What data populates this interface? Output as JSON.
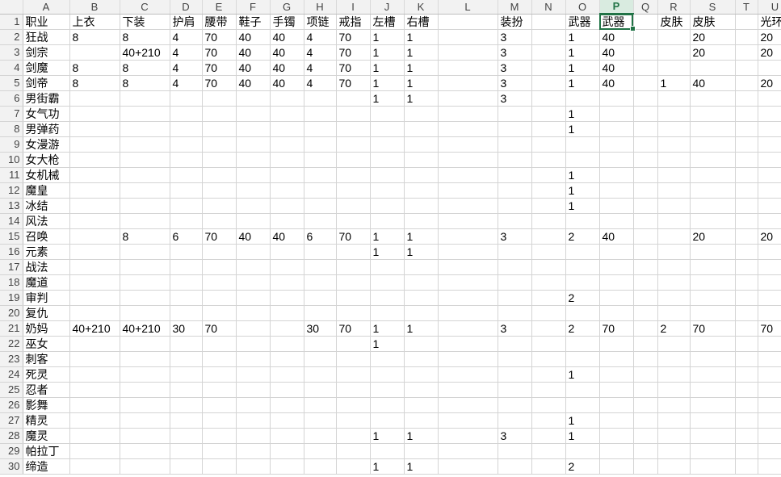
{
  "sheet": {
    "columns": [
      "A",
      "B",
      "C",
      "D",
      "E",
      "F",
      "G",
      "H",
      "I",
      "J",
      "K",
      "L",
      "M",
      "N",
      "O",
      "P",
      "Q",
      "R",
      "S",
      "T",
      "U"
    ],
    "active_column": "P",
    "selected_cell": "P1",
    "rows": [
      {
        "n": "1",
        "cells": [
          "职业",
          "上衣",
          "下装",
          "护肩",
          "腰带",
          "鞋子",
          "手镯",
          "项链",
          "戒指",
          "左槽",
          "右槽",
          "",
          "装扮",
          "",
          "武器",
          "武器",
          "",
          "皮肤",
          "皮肤",
          "",
          "光环"
        ]
      },
      {
        "n": "2",
        "cells": [
          "狂战",
          "8",
          "8",
          "4",
          "70",
          "40",
          "40",
          "4",
          "70",
          "1",
          "1",
          "",
          "3",
          "",
          "1",
          "40",
          "",
          "",
          "20",
          "",
          "20"
        ]
      },
      {
        "n": "3",
        "cells": [
          "剑宗",
          "",
          "40+210",
          "4",
          "70",
          "40",
          "40",
          "4",
          "70",
          "1",
          "1",
          "",
          "3",
          "",
          "1",
          "40",
          "",
          "",
          "20",
          "",
          "20"
        ]
      },
      {
        "n": "4",
        "cells": [
          "剑魔",
          "8",
          "8",
          "4",
          "70",
          "40",
          "40",
          "4",
          "70",
          "1",
          "1",
          "",
          "3",
          "",
          "1",
          "40",
          "",
          "",
          "",
          "",
          ""
        ]
      },
      {
        "n": "5",
        "cells": [
          "剑帝",
          "8",
          "8",
          "4",
          "70",
          "40",
          "40",
          "4",
          "70",
          "1",
          "1",
          "",
          "3",
          "",
          "1",
          "40",
          "",
          "1",
          "40",
          "",
          "20"
        ]
      },
      {
        "n": "6",
        "cells": [
          "男街霸",
          "",
          "",
          "",
          "",
          "",
          "",
          "",
          "",
          "1",
          "1",
          "",
          "3",
          "",
          "",
          "",
          "",
          "",
          "",
          "",
          ""
        ]
      },
      {
        "n": "7",
        "cells": [
          "女气功",
          "",
          "",
          "",
          "",
          "",
          "",
          "",
          "",
          "",
          "",
          "",
          "",
          "",
          "1",
          "",
          "",
          "",
          "",
          "",
          ""
        ]
      },
      {
        "n": "8",
        "cells": [
          "男弹药",
          "",
          "",
          "",
          "",
          "",
          "",
          "",
          "",
          "",
          "",
          "",
          "",
          "",
          "1",
          "",
          "",
          "",
          "",
          "",
          ""
        ]
      },
      {
        "n": "9",
        "cells": [
          "女漫游",
          "",
          "",
          "",
          "",
          "",
          "",
          "",
          "",
          "",
          "",
          "",
          "",
          "",
          "",
          "",
          "",
          "",
          "",
          "",
          ""
        ]
      },
      {
        "n": "10",
        "cells": [
          "女大枪",
          "",
          "",
          "",
          "",
          "",
          "",
          "",
          "",
          "",
          "",
          "",
          "",
          "",
          "",
          "",
          "",
          "",
          "",
          "",
          ""
        ]
      },
      {
        "n": "11",
        "cells": [
          "女机械",
          "",
          "",
          "",
          "",
          "",
          "",
          "",
          "",
          "",
          "",
          "",
          "",
          "",
          "1",
          "",
          "",
          "",
          "",
          "",
          ""
        ]
      },
      {
        "n": "12",
        "cells": [
          "魔皇",
          "",
          "",
          "",
          "",
          "",
          "",
          "",
          "",
          "",
          "",
          "",
          "",
          "",
          "1",
          "",
          "",
          "",
          "",
          "",
          ""
        ]
      },
      {
        "n": "13",
        "cells": [
          "冰结",
          "",
          "",
          "",
          "",
          "",
          "",
          "",
          "",
          "",
          "",
          "",
          "",
          "",
          "1",
          "",
          "",
          "",
          "",
          "",
          ""
        ]
      },
      {
        "n": "14",
        "cells": [
          "风法",
          "",
          "",
          "",
          "",
          "",
          "",
          "",
          "",
          "",
          "",
          "",
          "",
          "",
          "",
          "",
          "",
          "",
          "",
          "",
          ""
        ]
      },
      {
        "n": "15",
        "cells": [
          "召唤",
          "",
          "8",
          "6",
          "70",
          "40",
          "40",
          "6",
          "70",
          "1",
          "1",
          "",
          "3",
          "",
          "2",
          "40",
          "",
          "",
          "20",
          "",
          "20"
        ]
      },
      {
        "n": "16",
        "cells": [
          "元素",
          "",
          "",
          "",
          "",
          "",
          "",
          "",
          "",
          "1",
          "1",
          "",
          "",
          "",
          "",
          "",
          "",
          "",
          "",
          "",
          ""
        ]
      },
      {
        "n": "17",
        "cells": [
          "战法",
          "",
          "",
          "",
          "",
          "",
          "",
          "",
          "",
          "",
          "",
          "",
          "",
          "",
          "",
          "",
          "",
          "",
          "",
          "",
          ""
        ]
      },
      {
        "n": "18",
        "cells": [
          "魔道",
          "",
          "",
          "",
          "",
          "",
          "",
          "",
          "",
          "",
          "",
          "",
          "",
          "",
          "",
          "",
          "",
          "",
          "",
          "",
          ""
        ]
      },
      {
        "n": "19",
        "cells": [
          "审判",
          "",
          "",
          "",
          "",
          "",
          "",
          "",
          "",
          "",
          "",
          "",
          "",
          "",
          "2",
          "",
          "",
          "",
          "",
          "",
          ""
        ]
      },
      {
        "n": "20",
        "cells": [
          "复仇",
          "",
          "",
          "",
          "",
          "",
          "",
          "",
          "",
          "",
          "",
          "",
          "",
          "",
          "",
          "",
          "",
          "",
          "",
          "",
          ""
        ]
      },
      {
        "n": "21",
        "cells": [
          "奶妈",
          "40+210",
          "40+210",
          "30",
          "70",
          "",
          "",
          "30",
          "70",
          "1",
          "1",
          "",
          "3",
          "",
          "2",
          "70",
          "",
          "2",
          "70",
          "",
          "70"
        ]
      },
      {
        "n": "22",
        "cells": [
          "巫女",
          "",
          "",
          "",
          "",
          "",
          "",
          "",
          "",
          "1",
          "",
          "",
          "",
          "",
          "",
          "",
          "",
          "",
          "",
          "",
          ""
        ]
      },
      {
        "n": "23",
        "cells": [
          "刺客",
          "",
          "",
          "",
          "",
          "",
          "",
          "",
          "",
          "",
          "",
          "",
          "",
          "",
          "",
          "",
          "",
          "",
          "",
          "",
          ""
        ]
      },
      {
        "n": "24",
        "cells": [
          "死灵",
          "",
          "",
          "",
          "",
          "",
          "",
          "",
          "",
          "",
          "",
          "",
          "",
          "",
          "1",
          "",
          "",
          "",
          "",
          "",
          ""
        ]
      },
      {
        "n": "25",
        "cells": [
          "忍者",
          "",
          "",
          "",
          "",
          "",
          "",
          "",
          "",
          "",
          "",
          "",
          "",
          "",
          "",
          "",
          "",
          "",
          "",
          "",
          ""
        ]
      },
      {
        "n": "26",
        "cells": [
          "影舞",
          "",
          "",
          "",
          "",
          "",
          "",
          "",
          "",
          "",
          "",
          "",
          "",
          "",
          "",
          "",
          "",
          "",
          "",
          "",
          ""
        ]
      },
      {
        "n": "27",
        "cells": [
          "精灵",
          "",
          "",
          "",
          "",
          "",
          "",
          "",
          "",
          "",
          "",
          "",
          "",
          "",
          "1",
          "",
          "",
          "",
          "",
          "",
          ""
        ]
      },
      {
        "n": "28",
        "cells": [
          "魔灵",
          "",
          "",
          "",
          "",
          "",
          "",
          "",
          "",
          "1",
          "1",
          "",
          "3",
          "",
          "1",
          "",
          "",
          "",
          "",
          "",
          ""
        ]
      },
      {
        "n": "29",
        "cells": [
          "帕拉丁",
          "",
          "",
          "",
          "",
          "",
          "",
          "",
          "",
          "",
          "",
          "",
          "",
          "",
          "",
          "",
          "",
          "",
          "",
          "",
          ""
        ]
      },
      {
        "n": "30",
        "cells": [
          "缔造",
          "",
          "",
          "",
          "",
          "",
          "",
          "",
          "",
          "1",
          "1",
          "",
          "",
          "",
          "2",
          "",
          "",
          "",
          "",
          "",
          ""
        ]
      }
    ]
  }
}
